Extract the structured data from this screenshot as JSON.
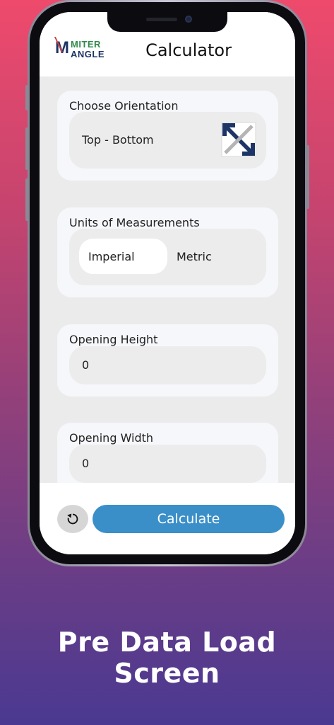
{
  "app": {
    "title": "Calculator",
    "logo_line1": "MITER",
    "logo_line2": "ANGLE"
  },
  "orientation": {
    "label": "Choose Orientation",
    "value": "Top - Bottom",
    "icon": "orientation-arrows-icon"
  },
  "units": {
    "label": "Units of Measurements",
    "options": [
      "Imperial",
      "Metric"
    ],
    "selected": "Imperial"
  },
  "opening_height": {
    "label": "Opening Height",
    "value": "0"
  },
  "opening_width": {
    "label": "Opening Width",
    "value": "0"
  },
  "actions": {
    "reset_icon": "reset-icon",
    "calculate_label": "Calculate"
  },
  "caption": "Pre Data Load Screen",
  "colors": {
    "accent": "#3a8fc8",
    "logo_navy": "#1d3566",
    "logo_green": "#2e8a4a"
  }
}
